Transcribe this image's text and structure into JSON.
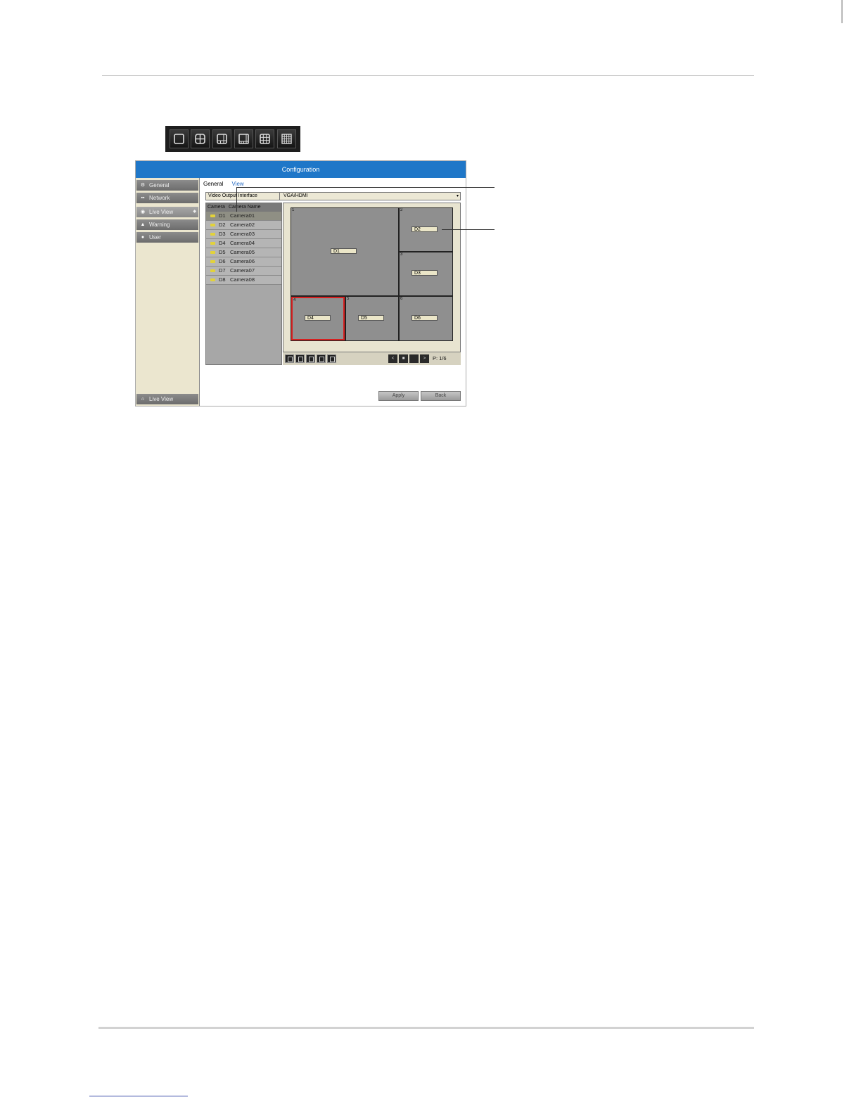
{
  "layout_strip": {
    "icons": [
      "single-view-icon",
      "quad-view-icon",
      "six-view-icon",
      "eight-view-icon",
      "nine-view-icon",
      "sixteen-view-icon"
    ]
  },
  "window": {
    "title": "Configuration",
    "sidebar": {
      "items": [
        {
          "label": "General",
          "icon": "gear-icon"
        },
        {
          "label": "Network",
          "icon": "network-icon"
        },
        {
          "label": "Live View",
          "icon": "eye-icon",
          "active": true
        },
        {
          "label": "Warning",
          "icon": "warning-icon"
        },
        {
          "label": "User",
          "icon": "user-icon"
        }
      ],
      "bottom_item": {
        "label": "Live View",
        "icon": "home-icon"
      }
    },
    "tabs": [
      {
        "label": "General"
      },
      {
        "label": "View",
        "active": true
      }
    ],
    "video_output": {
      "label": "Video Output Interface",
      "value": "VGA/HDMI"
    },
    "camera_list": {
      "headers": [
        "Camera",
        "Camera Name"
      ],
      "rows": [
        {
          "id": "D1",
          "name": "Camera01",
          "selected": true
        },
        {
          "id": "D2",
          "name": "Camera02"
        },
        {
          "id": "D3",
          "name": "Camera03"
        },
        {
          "id": "D4",
          "name": "Camera04"
        },
        {
          "id": "D5",
          "name": "Camera05"
        },
        {
          "id": "D6",
          "name": "Camera06"
        },
        {
          "id": "D7",
          "name": "Camera07"
        },
        {
          "id": "D8",
          "name": "Camera08"
        }
      ]
    },
    "grid": {
      "tiles": [
        {
          "num": "1",
          "label": "D1"
        },
        {
          "num": "2",
          "label": "D2"
        },
        {
          "num": "3",
          "label": "D3"
        },
        {
          "num": "4",
          "label": "D4",
          "selected": true
        },
        {
          "num": "5",
          "label": "D5"
        },
        {
          "num": "6",
          "label": "D6"
        }
      ]
    },
    "controls": {
      "nav": [
        "<",
        "■",
        "",
        ">"
      ],
      "page": "P: 1/6"
    },
    "buttons": {
      "apply": "Apply",
      "back": "Back"
    }
  }
}
